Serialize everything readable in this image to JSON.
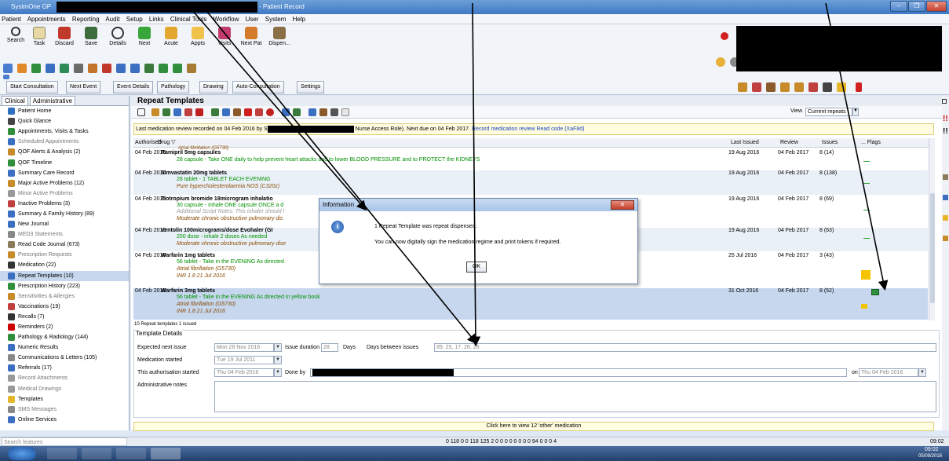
{
  "window": {
    "title_left": "SystmOne GP",
    "title_right": "- Patient Record",
    "controls": [
      "–",
      "❐",
      "✕"
    ]
  },
  "menu": [
    "Patient",
    "Appointments",
    "Reporting",
    "Audit",
    "Setup",
    "Links",
    "Clinical Tools",
    "Workflow",
    "User",
    "System",
    "Help"
  ],
  "toolbar": {
    "buttons": [
      {
        "label": "Search",
        "icon": "search-icon"
      },
      {
        "label": "Task",
        "icon": "task-icon"
      },
      {
        "label": "Discard",
        "icon": "discard-icon"
      },
      {
        "label": "Save",
        "icon": "save-icon"
      },
      {
        "label": "Details",
        "icon": "details-icon"
      },
      {
        "label": "Next",
        "icon": "next-icon"
      },
      {
        "label": "Acute",
        "icon": "acute-icon"
      },
      {
        "label": "Appts",
        "icon": "appts-icon"
      },
      {
        "label": "Visits",
        "icon": "visits-icon"
      },
      {
        "label": "Next Pat",
        "icon": "next-patient-icon"
      },
      {
        "label": "Dispen...",
        "icon": "dispense-icon"
      }
    ]
  },
  "tabs": [
    "Start Consultation",
    "Next Event",
    "Event Details",
    "Pathology",
    "Drawing",
    "Auto-Consultation",
    "Settings"
  ],
  "sidebar": {
    "tabs": [
      "Clinical",
      "Administrative"
    ],
    "items": [
      {
        "label": "Patient Home"
      },
      {
        "label": "Quick Glance"
      },
      {
        "label": "Appointments, Visits & Tasks"
      },
      {
        "label": "Scheduled Appointments",
        "grey": true
      },
      {
        "label": "QOF Alerts & Analysis (2)"
      },
      {
        "label": "QOF Timeline"
      },
      {
        "label": "Summary Care Record"
      },
      {
        "label": "Major Active Problems (12)"
      },
      {
        "label": "Minor Active Problems",
        "grey": true
      },
      {
        "label": "Inactive Problems (3)"
      },
      {
        "label": "Summary & Family History (89)"
      },
      {
        "label": "New Journal"
      },
      {
        "label": "MED3 Statements",
        "grey": true
      },
      {
        "label": "Read Code Journal (673)"
      },
      {
        "label": "Prescription Requests",
        "grey": true
      },
      {
        "label": "Medication (22)"
      },
      {
        "label": "Repeat Templates (10)",
        "selected": true
      },
      {
        "label": "Prescription History (223)"
      },
      {
        "label": "Sensitivities & Allergies",
        "grey": true
      },
      {
        "label": "Vaccinations (19)"
      },
      {
        "label": "Recalls (7)"
      },
      {
        "label": "Reminders (2)"
      },
      {
        "label": "Pathology & Radiology (144)"
      },
      {
        "label": "Numeric Results"
      },
      {
        "label": "Communications & Letters (105)"
      },
      {
        "label": "Referrals (17)"
      },
      {
        "label": "Record Attachments",
        "grey": true
      },
      {
        "label": "Medical Drawings",
        "grey": true
      },
      {
        "label": "Templates"
      },
      {
        "label": "SMS Messages",
        "grey": true
      },
      {
        "label": "Online Services"
      }
    ]
  },
  "main": {
    "title": "Repeat Templates",
    "view_label": "View",
    "view_value": "Current repeats",
    "notice_a": "Last medication review recorded on 04 Feb 2016 by S",
    "notice_b": "Nurse Access Role). Next due on 04 Feb 2017.",
    "notice_link": "Record medication review Read code (XaF8d)",
    "columns": {
      "authorised": "Authorised",
      "drug": "Drug ▽",
      "last_issued": "Last Issued",
      "review": "Review",
      "issues": "Issues",
      "flags": "... Flags"
    },
    "partial_top": "Atrial fibrillation (G5730)",
    "rows": [
      {
        "date": "04 Feb 2016",
        "drug": "Ramipril 5mg capsules",
        "line2": "28 capsule - Take ONE  daily to help prevent heart attacks and to lower BLOOD PRESSURE and to PROTECT the KIDNEYS",
        "line3": "",
        "last_issued": "19 Aug 2016",
        "review": "04 Feb 2017",
        "issues": "8 (14)"
      },
      {
        "date": "04 Feb 2016",
        "drug": "Simvastatin 20mg tablets",
        "line2": "28 tablet - 1 TABLET EACH EVENING",
        "line3": "Pure hypercholesterolaemia NOS (C320z)",
        "last_issued": "19 Aug 2016",
        "review": "04 Feb 2017",
        "issues": "8 (138)"
      },
      {
        "date": "04 Feb 2016",
        "drug": "Tiotropium bromide 18microgram inhalatio",
        "line2": "30 capsule - Inhale ONE capsule ONCE a d",
        "line3": "Additional Script Notes: This inhaler should l",
        "line4": "Moderate chronic obstructive pulmonary dis",
        "last_issued": "19 Aug 2016",
        "review": "04 Feb 2017",
        "issues": "8 (69)"
      },
      {
        "date": "04 Feb 2016",
        "drug": "Ventolin 100micrograms/dose Evohaler (GI",
        "line2": "200 dose - inhale 2 doses As needed",
        "line3": "Moderate chronic obstructive pulmonary dise",
        "last_issued": "19 Aug 2016",
        "review": "04 Feb 2017",
        "issues": "8 (63)"
      },
      {
        "date": "04 Feb 2016",
        "drug": "Warfarin 1mg tablets",
        "line2": "56 tablet - Take in the EVENING As directed",
        "line3": "Atrial fibrillation (G5730)",
        "line4": "INR 1.8  21 Jul 2016",
        "last_issued": "25 Jul 2016",
        "review": "04 Feb 2017",
        "issues": "3 (43)"
      },
      {
        "date": "04 Feb 2016",
        "drug": "Warfarin 3mg tablets",
        "line2": "56 tablet - Take in the EVENING As directed in yellow book",
        "line3": "Atrial fibrillation (G5730)",
        "line4": "INR 1.8  21 Jul 2016",
        "last_issued": "31 Oct 2016",
        "review": "04 Feb 2017",
        "issues": "8 (52)"
      }
    ],
    "count_text": "10 Repeat templates  1 issued",
    "details": {
      "heading": "Template Details",
      "expected_next_issue_label": "Expected next issue",
      "expected_next_issue": "Mon 28 Nov 2016",
      "issue_duration_label": "Issue duration",
      "issue_duration": "28",
      "days_label": "Days",
      "days_between_label": "Days between issues",
      "days_between": "89, 25, 17, 28, 28",
      "medication_started_label": "Medication started",
      "medication_started": "Tue 19 Jul 2011",
      "auth_started_label": "This authorisation started",
      "auth_started": "Thu 04 Feb 2016",
      "done_by_label": "Done by",
      "on_label": "on",
      "on_value": "Thu 04 Feb 2016",
      "admin_notes_label": "Administrative notes"
    },
    "click_bar": "Click here to view 12 'other' medication"
  },
  "dialog": {
    "title": "Information",
    "close": "✕",
    "line1": "1 Repeat Template was repeat dispensed.",
    "line2": "You can now digitally sign the medication regime and print tokens if required.",
    "ok": "OK"
  },
  "status": {
    "search_placeholder": "Search features",
    "counts": "0  118  0  0  118   125  2    0  0  0  0  0    0  0  0    94  0    0  0  4",
    "time": "09:02"
  },
  "taskbar": {
    "clock_time": "09:02",
    "clock_date": "05/09/2016"
  }
}
